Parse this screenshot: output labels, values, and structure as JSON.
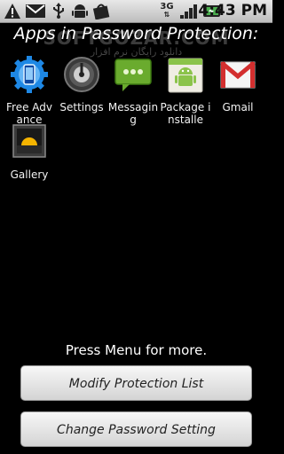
{
  "status_bar": {
    "time": "4:43",
    "ampm": "PM",
    "network_label": "3G",
    "icons": [
      "warning-icon",
      "gmail-notification-icon",
      "usb-icon",
      "android-icon",
      "market-icon",
      "3g-icon",
      "signal-icon",
      "battery-icon"
    ]
  },
  "watermark": {
    "main": "SOFTGOZAR.COM",
    "sub": "دانلود رایگان نرم افزار"
  },
  "heading": "Apps in Password Protection:",
  "apps": [
    {
      "label": "Free Advance",
      "icon": "free-advance-icon"
    },
    {
      "label": "Settings",
      "icon": "settings-icon"
    },
    {
      "label": "Messaging",
      "icon": "messaging-icon"
    },
    {
      "label": "Package installe",
      "icon": "package-installer-icon"
    },
    {
      "label": "Gmail",
      "icon": "gmail-icon"
    },
    {
      "label": "Gallery",
      "icon": "gallery-icon"
    }
  ],
  "hint": "Press Menu for more.",
  "buttons": {
    "modify": "Modify Protection List",
    "change_password": "Change Password Setting"
  },
  "colors": {
    "background": "#000000",
    "status_bar": "#c9c9c9",
    "button": "#e6e6e6"
  }
}
